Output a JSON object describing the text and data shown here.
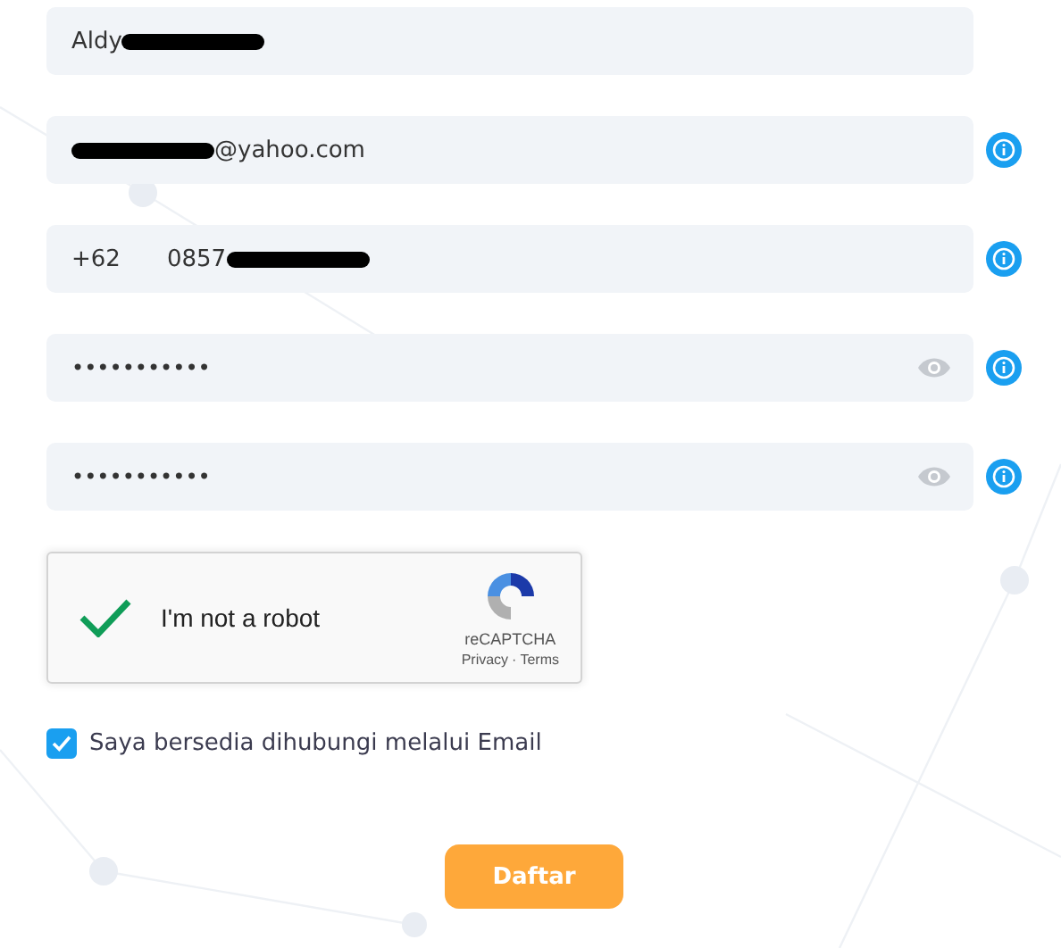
{
  "fields": [
    {
      "kind": "text",
      "value": "Aldy",
      "redacted_after": true
    },
    {
      "kind": "text",
      "value": "@yahoo.com",
      "redacted_before": true,
      "info": true
    },
    {
      "kind": "phone",
      "prefix": "+62",
      "value": "0857",
      "redacted_after": true,
      "info": true
    },
    {
      "kind": "password",
      "value": "•••••••••••",
      "info": true
    },
    {
      "kind": "password",
      "value": "•••••••••••",
      "info": true
    }
  ],
  "captcha": {
    "checked": true,
    "label": "I'm not a robot",
    "brand": "reCAPTCHA",
    "privacy": "Privacy",
    "separator": "·",
    "terms": "Terms"
  },
  "consent": {
    "checked": true,
    "label": "Saya bersedia dihubungi melalui Email"
  },
  "submit": {
    "label": "Daftar"
  }
}
